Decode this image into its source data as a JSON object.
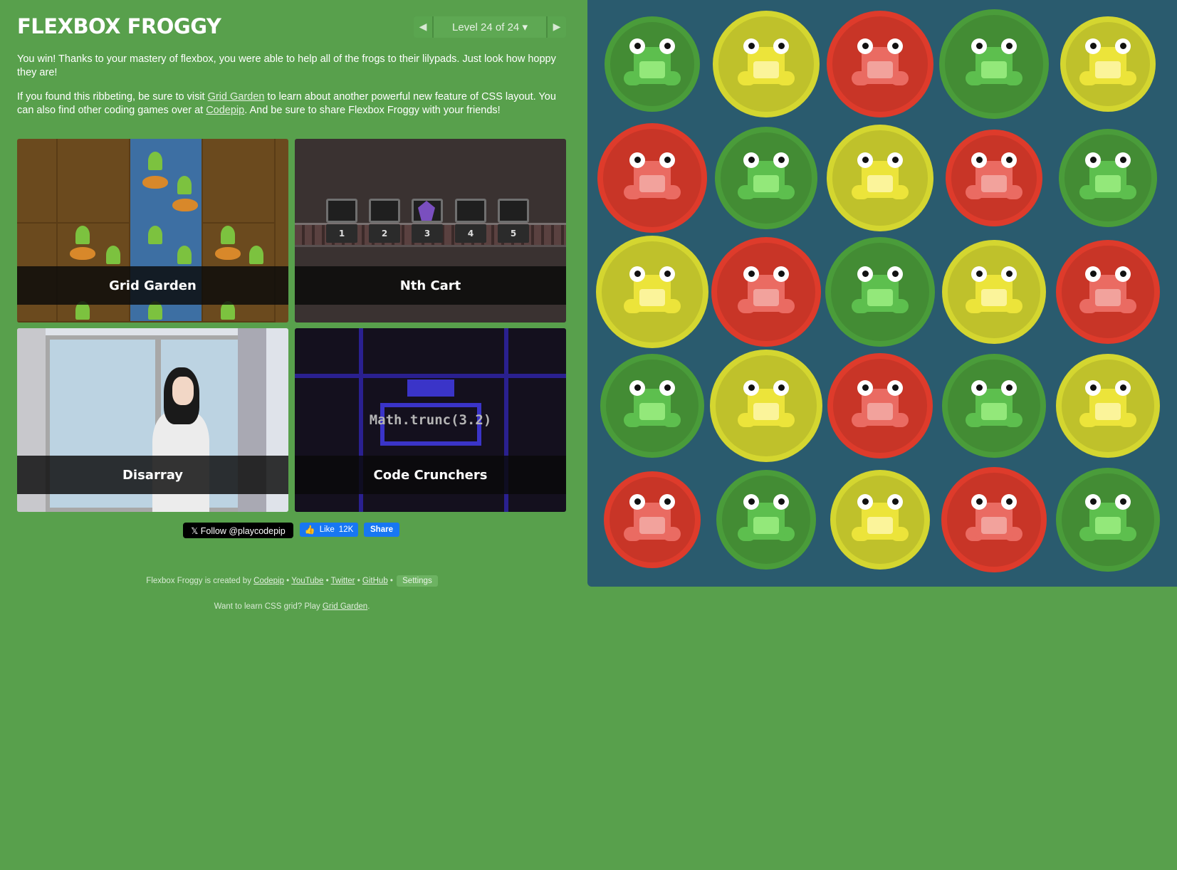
{
  "header": {
    "title": "FLEXBOX FROGGY",
    "level_label": "Level 24 of 24 ▾",
    "prev_arrow": "◀",
    "next_arrow": "▶"
  },
  "content": {
    "win_text": "You win! Thanks to your mastery of flexbox, you were able to help all of the frogs to their lilypads. Just look how hoppy they are!",
    "visit_text_1": "If you found this ribbeting, be sure to visit ",
    "visit_link_1": "Grid Garden",
    "visit_text_2": " to learn about another powerful new feature of CSS layout. You can also find other coding games over at ",
    "visit_link_2": "Codepip",
    "visit_text_3": ". And be sure to share Flexbox Froggy with your friends!"
  },
  "games": [
    {
      "name": "Grid Garden"
    },
    {
      "name": "Nth Cart"
    },
    {
      "name": "Disarray"
    },
    {
      "name": "Code Crunchers",
      "screen_text": "Math.trunc(3.2)"
    }
  ],
  "nth_cart_numbers": [
    "1",
    "2",
    "3",
    "4",
    "5"
  ],
  "social": {
    "twitter_follow": "𝕏 Follow @playcodepip",
    "fb_like": "Like",
    "fb_like_count": "12K",
    "fb_share": "Share"
  },
  "footer": {
    "credits_prefix": "Flexbox Froggy is created by ",
    "codepip": "Codepip",
    "sep": " • ",
    "youtube": "YouTube",
    "twitter": "Twitter",
    "github": "GitHub",
    "settings": "Settings",
    "grid_prefix": "Want to learn CSS grid? Play ",
    "grid_link": "Grid Garden",
    "grid_suffix": "."
  },
  "pond": {
    "rows": [
      [
        "green",
        "yellow",
        "red",
        "green",
        "yellow"
      ],
      [
        "red",
        "green",
        "yellow",
        "red",
        "green"
      ],
      [
        "yellow",
        "red",
        "green",
        "yellow",
        "red"
      ],
      [
        "green",
        "yellow",
        "red",
        "green",
        "yellow"
      ],
      [
        "red",
        "green",
        "yellow",
        "red",
        "green"
      ]
    ]
  },
  "colors": {
    "background": "#58a04c",
    "pond": "#2a5b6e",
    "green": "#4a9c3a",
    "yellow": "#d4d630",
    "red": "#de3b2b"
  }
}
